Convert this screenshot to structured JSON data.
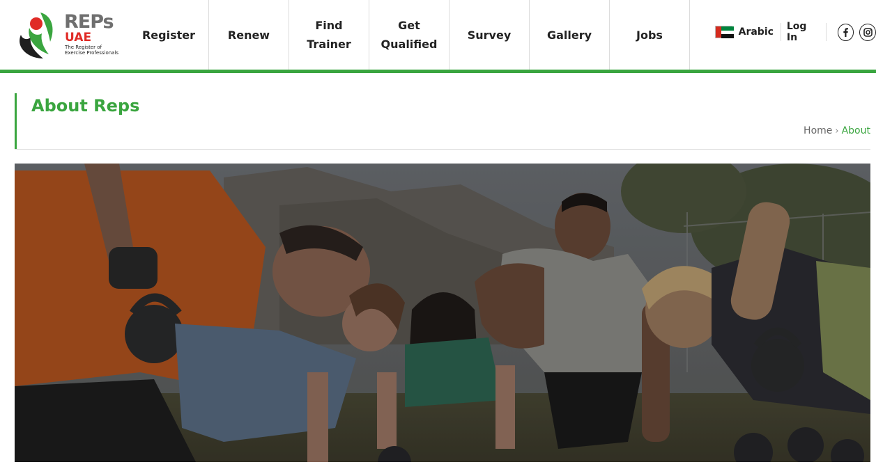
{
  "brand": {
    "name": "REPs",
    "country": "UAE",
    "tagline_line1": "The Register of",
    "tagline_line2": "Exercise Professionals"
  },
  "nav": {
    "items": [
      {
        "label": "Register"
      },
      {
        "label": "Renew"
      },
      {
        "label": "Find\nTrainer"
      },
      {
        "label": "Get\nQualified"
      },
      {
        "label": "Survey"
      },
      {
        "label": "Gallery"
      },
      {
        "label": "Jobs"
      }
    ]
  },
  "utility": {
    "language_label": "Arabic",
    "login_label": "Log In",
    "social": [
      "facebook-icon",
      "instagram-icon"
    ]
  },
  "page": {
    "title": "About Reps",
    "breadcrumb": {
      "home": "Home",
      "current": "About"
    }
  },
  "colors": {
    "accent": "#3aa53f",
    "brand_red": "#e02b26",
    "text": "#222222"
  }
}
